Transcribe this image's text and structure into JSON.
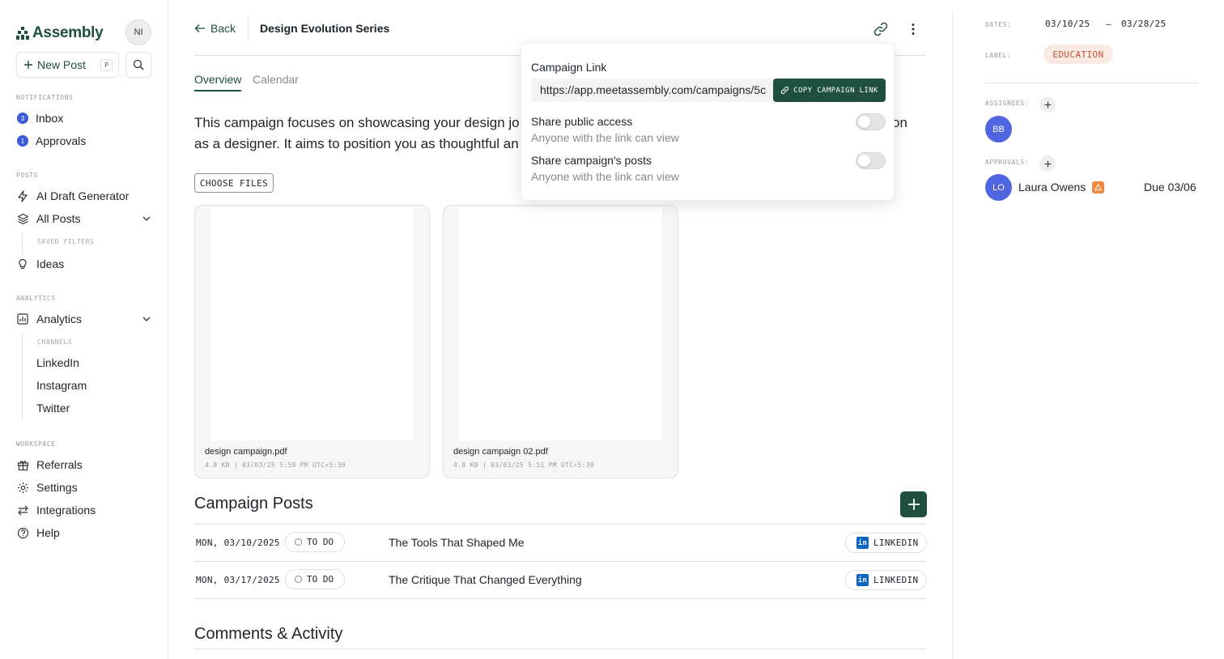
{
  "sidebar": {
    "brand": "Assembly",
    "avatar_initials": "NI",
    "new_post_label": "New Post",
    "new_post_shortcut": "P",
    "sections": {
      "notifications": "NOTIFICATIONS",
      "posts": "POSTS",
      "analytics": "ANALYTICS",
      "workspace": "WORKSPACE"
    },
    "inbox": {
      "label": "Inbox",
      "count": "3"
    },
    "approvals": {
      "label": "Approvals",
      "count": "1"
    },
    "ai_draft": "AI Draft Generator",
    "all_posts": "All Posts",
    "saved_filters": "SAVED FILTERS",
    "ideas": "Ideas",
    "analytics_item": "Analytics",
    "channels_label": "CHANNELS",
    "channels": [
      "LinkedIn",
      "Instagram",
      "Twitter"
    ],
    "referrals": "Referrals",
    "settings": "Settings",
    "integrations": "Integrations",
    "help": "Help"
  },
  "header": {
    "back_label": "Back",
    "title": "Design Evolution Series"
  },
  "tabs": {
    "overview": "Overview",
    "calendar": "Calendar"
  },
  "description": "This campaign focuses on showcasing your design jo",
  "description_tail": "on",
  "description_line2": "as a designer. It aims to position you as thoughtful an",
  "choose_files": "CHOOSE FILES",
  "files": [
    {
      "name": "design campaign.pdf",
      "meta": "4.8 KB | 03/03/25 5:50 PM UTC+5:30"
    },
    {
      "name": "design campaign 02.pdf",
      "meta": "4.8 KB | 03/03/25 5:51 PM UTC+5:30"
    }
  ],
  "campaign_posts": {
    "heading": "Campaign Posts",
    "rows": [
      {
        "date": "MON, 03/10/2025",
        "status": "TO DO",
        "title": "The Tools That Shaped Me",
        "channel": "LINKEDIN"
      },
      {
        "date": "MON, 03/17/2025",
        "status": "TO DO",
        "title": "The Critique That Changed Everything",
        "channel": "LINKEDIN"
      }
    ]
  },
  "comments_heading": "Comments & Activity",
  "popover": {
    "title": "Campaign Link",
    "url": "https://app.meetassembly.com/campaigns/5c",
    "copy_label": "COPY CAMPAIGN LINK",
    "share_public": {
      "title": "Share public access",
      "sub": "Anyone with the link can view"
    },
    "share_posts": {
      "title": "Share campaign's posts",
      "sub": "Anyone with the link can view"
    }
  },
  "details": {
    "dates_label": "DATES:",
    "start_date": "03/10/25",
    "date_sep": "—",
    "end_date": "03/28/25",
    "label_label": "LABEL:",
    "label_value": "EDUCATION",
    "assignees_label": "ASSIGNEES:",
    "assignee_initials": "BB",
    "approvals_label": "APPROVALS:",
    "approver_initials": "LO",
    "approver_name": "Laura Owens",
    "approver_due": "Due 03/06"
  },
  "colors": {
    "brand_green": "#1f4f3f",
    "badge_blue": "#3b5bdb",
    "avatar_blue": "#4f66e0",
    "label_bg": "#fbe9e4",
    "label_fg": "#c0573a",
    "warning": "#f0883e",
    "linkedin": "#0a66c2"
  }
}
